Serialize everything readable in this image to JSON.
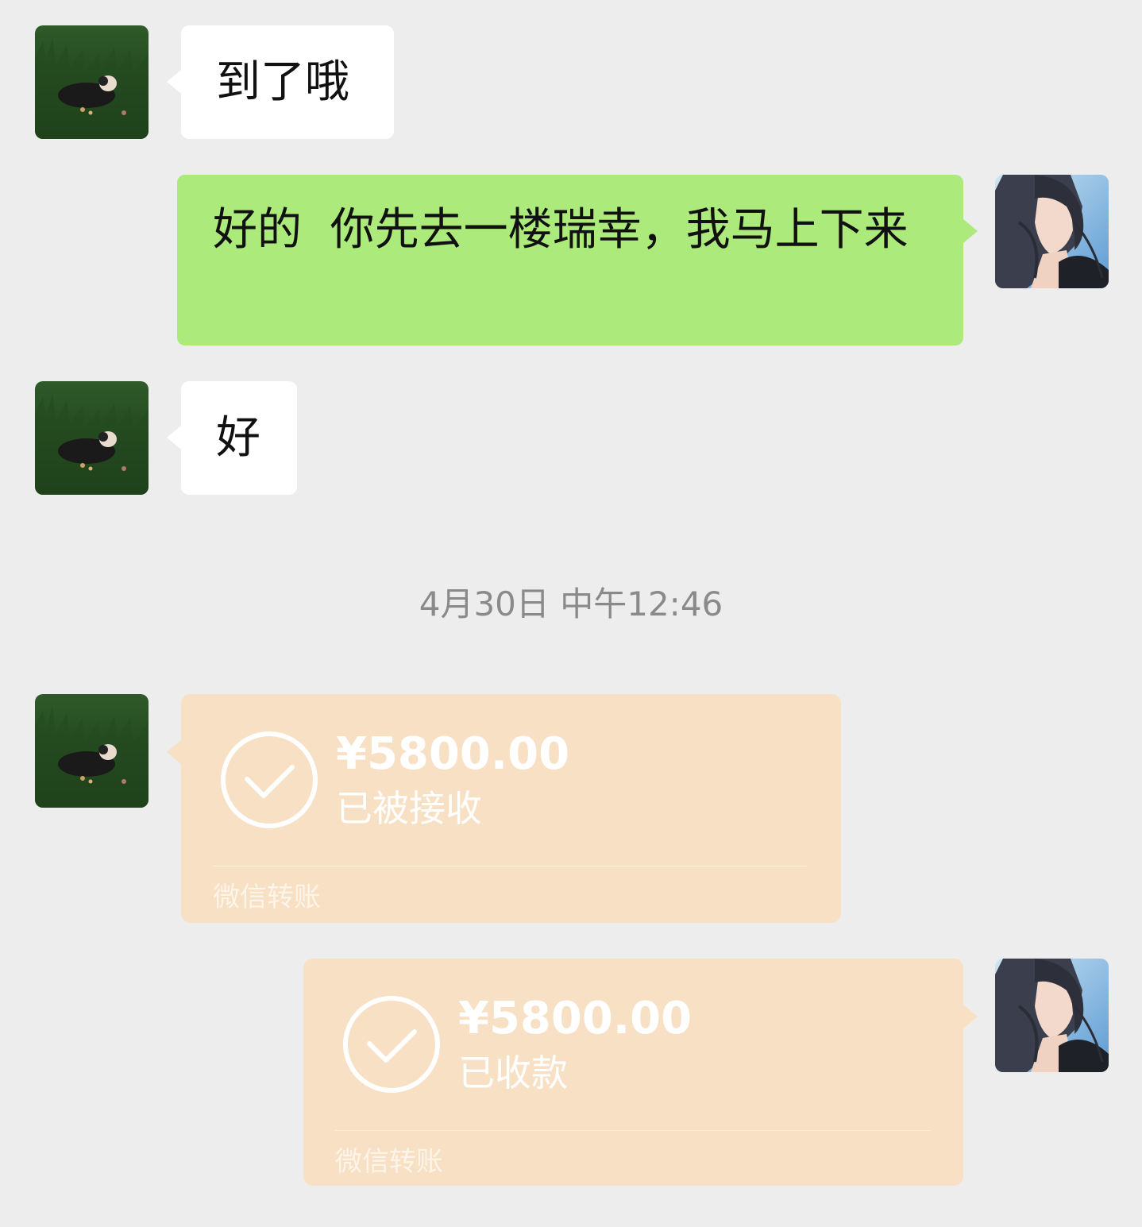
{
  "messages": [
    {
      "text": "到了哦"
    },
    {
      "text": "好的  你先去一楼瑞幸，我马上下来"
    },
    {
      "text": "好"
    }
  ],
  "timestamp": "4月30日 中午12:46",
  "transfers": [
    {
      "amount": "¥5800.00",
      "status": "已被接收",
      "brand": "微信转账"
    },
    {
      "amount": "¥5800.00",
      "status": "已收款",
      "brand": "微信转账"
    }
  ],
  "icons": {
    "contact_avatar": "grass-field-avatar",
    "self_avatar": "anime-portrait-avatar",
    "transfer_status": "check-circle-icon"
  },
  "colors": {
    "background": "#ededed",
    "incoming_bubble": "#ffffff",
    "outgoing_bubble": "#aceb7b",
    "transfer_card": "#f7e0c3",
    "timestamp_text": "#8a8a8a"
  }
}
